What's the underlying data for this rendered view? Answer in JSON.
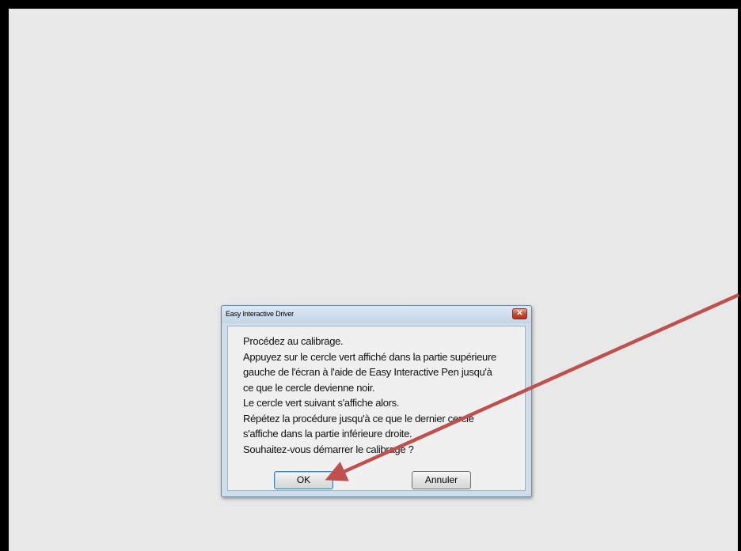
{
  "dialog": {
    "title": "Easy Interactive Driver",
    "close_glyph": "✕",
    "message_lines": [
      "Procédez au calibrage.",
      "Appuyez sur le cercle vert affiché dans la partie supérieure",
      "gauche de l'écran à l'aide de Easy Interactive Pen jusqu'à",
      "ce que le cercle devienne noir.",
      "Le cercle vert suivant s'affiche alors.",
      "Répétez la procédure jusqu'à ce que le dernier cercle",
      "s'affiche dans la partie inférieure droite.",
      "Souhaitez-vous démarrer le calibrage ?"
    ],
    "ok_label": "OK",
    "cancel_label": "Annuler"
  },
  "annotation": {
    "arrow_color": "#c0504d"
  }
}
